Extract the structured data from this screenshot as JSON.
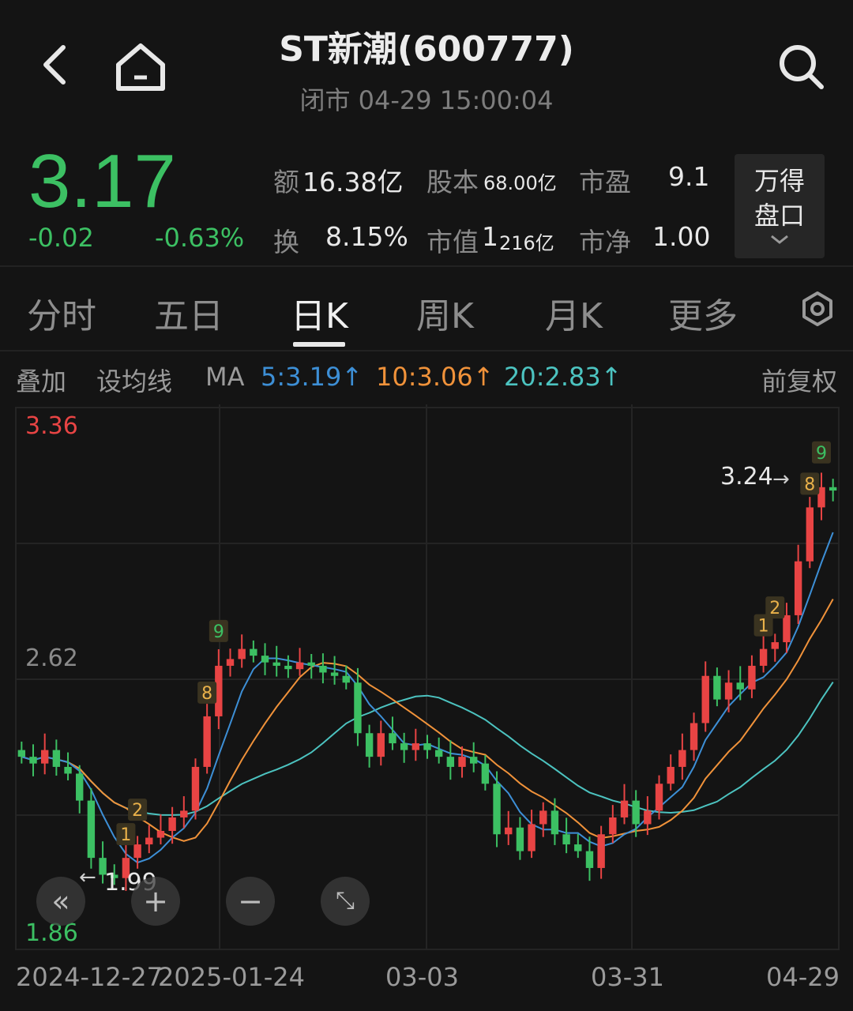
{
  "header": {
    "title": "ST新潮(600777)",
    "status": "闭市 04-29 15:00:04"
  },
  "quote": {
    "price": "3.17",
    "change": "-0.02",
    "change_pct": "-0.63%",
    "amount_label": "额",
    "amount_value": "16.38亿",
    "shares_label": "股本",
    "shares_value": "68.00亿",
    "pe_label": "市盈",
    "pe_value": "9.1",
    "turnover_label": "换",
    "turnover_value": "8.15%",
    "mcap_label": "市值",
    "mcap_value_big": "1",
    "mcap_value_small": "216亿",
    "pb_label": "市净",
    "pb_value": "1.00",
    "wind_button": [
      "万得",
      "盘口"
    ]
  },
  "tabs": [
    {
      "label": "分时"
    },
    {
      "label": "五日"
    },
    {
      "label": "日K",
      "active": true
    },
    {
      "label": "周K"
    },
    {
      "label": "月K"
    },
    {
      "label": "更多"
    }
  ],
  "ma_bar": {
    "overlay": "叠加",
    "set_ma": "设均线",
    "ma": "MA",
    "ma5": "5:3.19↑",
    "ma10": "10:3.06↑",
    "ma20": "20:2.83↑",
    "adjust": "前复权",
    "colors": {
      "ma5": "#3d8fd6",
      "ma10": "#f0923a",
      "ma20": "#4cc3c0"
    }
  },
  "chart_data": {
    "type": "candlestick",
    "y_axis_labels": [
      "3.36",
      "2.62",
      "1.86"
    ],
    "ylim": [
      1.86,
      3.36
    ],
    "x_labels": [
      "2024-12-27",
      "2025-01-24",
      "03-03",
      "03-31",
      "04-29"
    ],
    "max_marker": "3.24",
    "min_marker": "1.99",
    "signals": [
      "1",
      "2",
      "8",
      "9",
      "1",
      "2",
      "8",
      "9"
    ],
    "up_color": "#e84444",
    "down_color": "#3cc063",
    "close_approx": [
      2.38,
      2.36,
      2.4,
      2.35,
      2.33,
      2.25,
      2.08,
      2.03,
      2.02,
      2.08,
      2.12,
      2.14,
      2.16,
      2.2,
      2.22,
      2.35,
      2.5,
      2.65,
      2.67,
      2.7,
      2.68,
      2.66,
      2.65,
      2.64,
      2.66,
      2.65,
      2.63,
      2.62,
      2.6,
      2.45,
      2.38,
      2.45,
      2.42,
      2.4,
      2.42,
      2.4,
      2.38,
      2.35,
      2.38,
      2.36,
      2.3,
      2.15,
      2.17,
      2.1,
      2.18,
      2.22,
      2.15,
      2.12,
      2.1,
      2.05,
      2.15,
      2.2,
      2.25,
      2.18,
      2.22,
      2.3,
      2.35,
      2.4,
      2.48,
      2.62,
      2.55,
      2.6,
      2.58,
      2.65,
      2.7,
      2.72,
      2.8,
      2.96,
      3.12,
      3.18,
      3.17
    ]
  }
}
